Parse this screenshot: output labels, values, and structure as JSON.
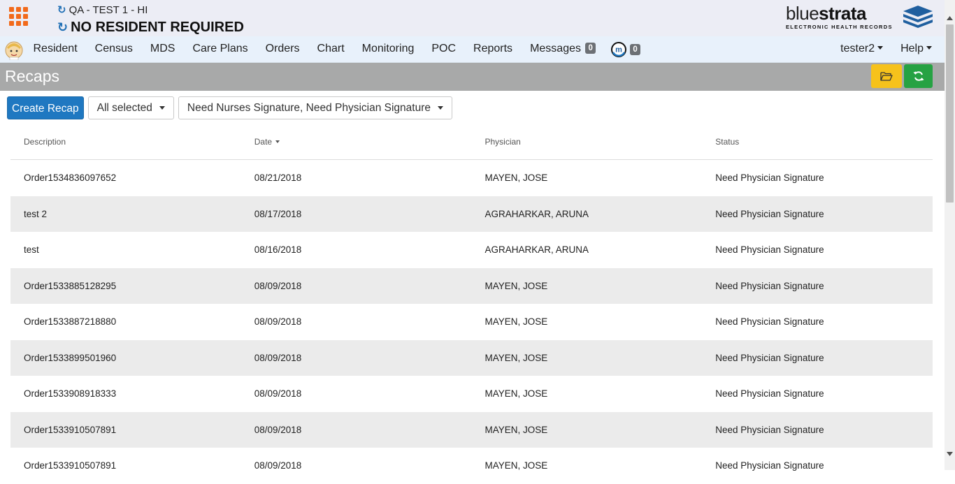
{
  "header": {
    "facility": "QA - TEST 1 - HI",
    "resident": "NO RESIDENT REQUIRED",
    "brand": {
      "name_light": "blue",
      "name_bold": "strata",
      "tagline": "ELECTRONIC HEALTH RECORDS"
    }
  },
  "nav": {
    "items": [
      "Resident",
      "Census",
      "MDS",
      "Care Plans",
      "Orders",
      "Chart",
      "Monitoring",
      "POC",
      "Reports"
    ],
    "messages_label": "Messages",
    "messages_count": "0",
    "m_count": "0",
    "user": "tester2",
    "help": "Help"
  },
  "page": {
    "title": "Recaps",
    "create_button": "Create Recap",
    "filter1": "All selected",
    "filter2": "Need Nurses Signature, Need Physician Signature"
  },
  "table": {
    "headers": [
      "Description",
      "Date",
      "Physician",
      "Status"
    ],
    "rows": [
      [
        "Order1534836097652",
        "08/21/2018",
        "MAYEN, JOSE",
        "Need Physician Signature"
      ],
      [
        "test 2",
        "08/17/2018",
        "AGRAHARKAR, ARUNA",
        "Need Physician Signature"
      ],
      [
        "test",
        "08/16/2018",
        "AGRAHARKAR, ARUNA",
        "Need Physician Signature"
      ],
      [
        "Order1533885128295",
        "08/09/2018",
        "MAYEN, JOSE",
        "Need Physician Signature"
      ],
      [
        "Order1533887218880",
        "08/09/2018",
        "MAYEN, JOSE",
        "Need Physician Signature"
      ],
      [
        "Order1533899501960",
        "08/09/2018",
        "MAYEN, JOSE",
        "Need Physician Signature"
      ],
      [
        "Order1533908918333",
        "08/09/2018",
        "MAYEN, JOSE",
        "Need Physician Signature"
      ],
      [
        "Order1533910507891",
        "08/09/2018",
        "MAYEN, JOSE",
        "Need Physician Signature"
      ],
      [
        "Order1533910507891",
        "08/09/2018",
        "MAYEN, JOSE",
        "Need Physician Signature"
      ]
    ]
  },
  "colors": {
    "accent_orange": "#f26a1b",
    "primary_blue": "#1f78c1",
    "warning_yellow": "#f6c21b",
    "success_green": "#26a243",
    "title_bar_gray": "#a8a9a9"
  },
  "icons": {
    "apps": "apps-grid-icon",
    "refresh": "refresh-icon",
    "folder": "folder-open-icon",
    "avatar": "nurse-avatar-icon",
    "m": "m-messages-icon",
    "scroll_up": "scroll-up-arrow-icon",
    "scroll_down": "scroll-down-arrow-icon"
  }
}
